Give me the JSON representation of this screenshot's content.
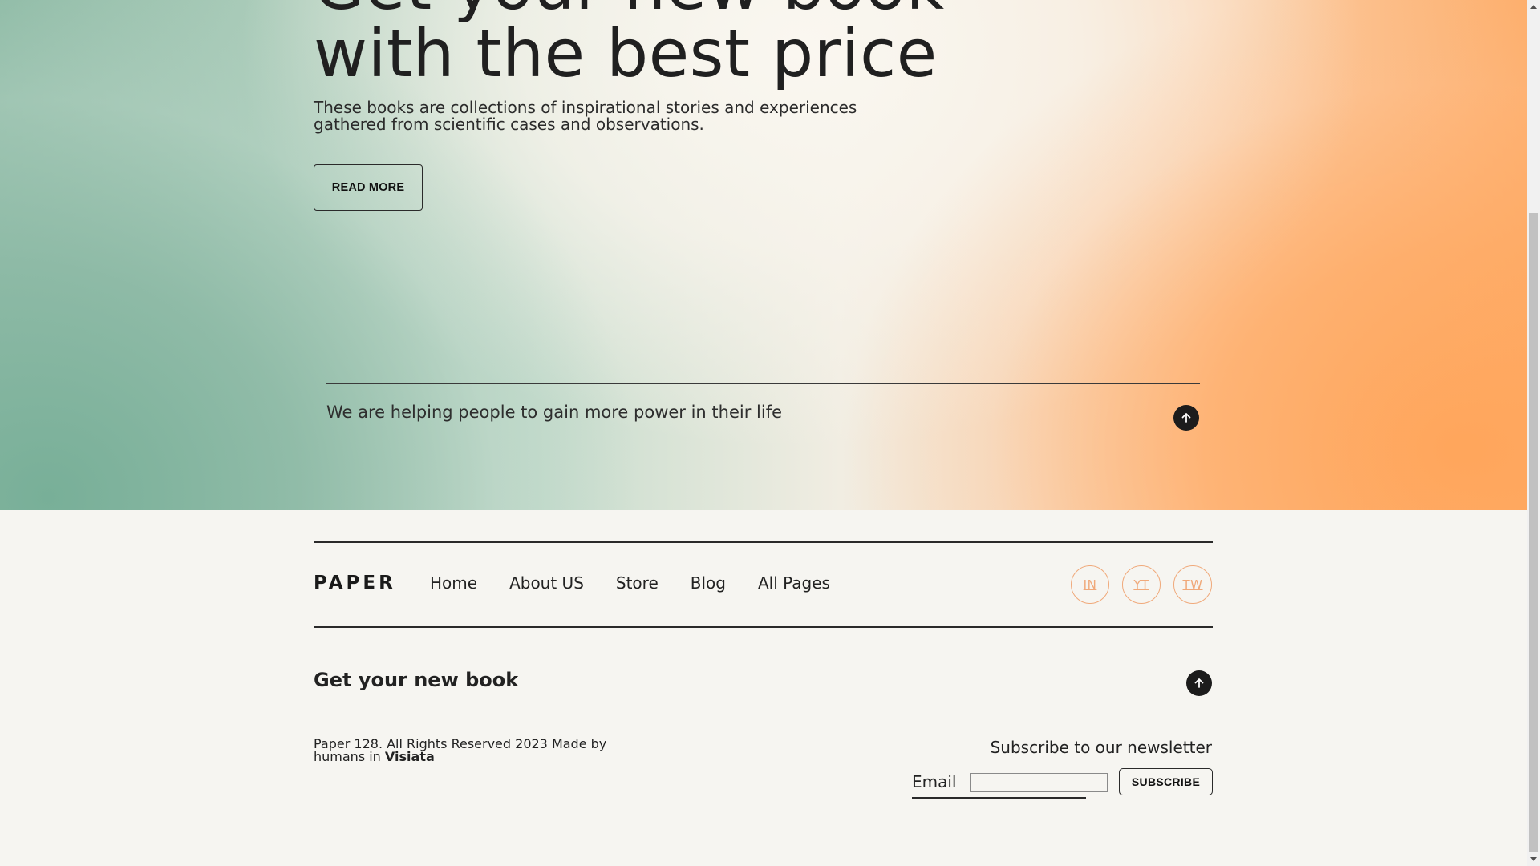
{
  "hero": {
    "title_line1": "Get your new book",
    "title_line2": "with the best price",
    "subtitle": "These books are collections of inspirational stories and experiences gathered from scientific cases and observations.",
    "read_more_label": "READ MORE",
    "tagline": "We are helping people to gain more power in their life",
    "up_icon": "arrow-up-icon"
  },
  "footer": {
    "logo": "PAPER",
    "nav": [
      "Home",
      "About US",
      "Store",
      "Blog",
      "All Pages"
    ],
    "social": [
      "IN",
      "YT",
      "TW"
    ],
    "title": "Get your new book",
    "up_icon": "arrow-up-icon",
    "copyright_text": "Paper 128. All Rights Reserved 2023 Made by humans in",
    "copyright_brand": "Visiata",
    "newsletter_title": "Subscribe to our newsletter",
    "email_label": "Email",
    "email_value": "",
    "subscribe_label": "SUBSCRIBE"
  },
  "colors": {
    "accent_orange": "#fdae6b",
    "accent_green": "#8fbba6",
    "social_outline": "#f0a97a",
    "background": "#f6f5f1",
    "text": "#1e1e1e"
  }
}
